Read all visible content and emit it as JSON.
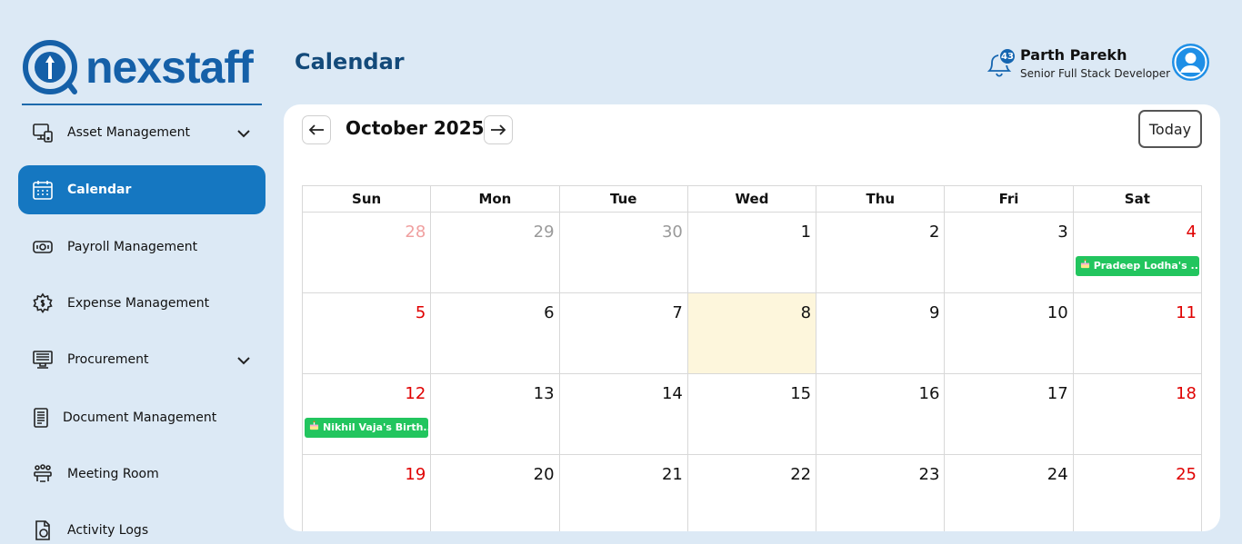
{
  "brand": {
    "name": "nexstaff"
  },
  "sidebar": {
    "items": [
      {
        "label": "Asset Management",
        "icon": "monitor-phone-icon",
        "expandable": true,
        "active": false
      },
      {
        "label": "Calendar",
        "icon": "calendar-icon",
        "expandable": false,
        "active": true
      },
      {
        "label": "Payroll Management",
        "icon": "money-icon",
        "expandable": false,
        "active": false
      },
      {
        "label": "Expense Management",
        "icon": "gear-dollar-icon",
        "expandable": false,
        "active": false
      },
      {
        "label": "Procurement",
        "icon": "desktop-icon",
        "expandable": true,
        "active": false
      },
      {
        "label": "Document Management",
        "icon": "document-icon",
        "expandable": false,
        "active": false
      },
      {
        "label": "Meeting Room",
        "icon": "meeting-icon",
        "expandable": false,
        "active": false
      },
      {
        "label": "Activity Logs",
        "icon": "activity-log-icon",
        "expandable": false,
        "active": false
      }
    ]
  },
  "header": {
    "title": "Calendar",
    "notifications": "43",
    "user": {
      "name": "Parth Parekh",
      "role": "Senior Full Stack Developer"
    }
  },
  "calendar": {
    "month_label": "October 2025",
    "today_label": "Today",
    "weekdays": [
      "Sun",
      "Mon",
      "Tue",
      "Wed",
      "Thu",
      "Fri",
      "Sat"
    ],
    "weeks": [
      [
        {
          "day": "28",
          "other": true
        },
        {
          "day": "29",
          "other": true
        },
        {
          "day": "30",
          "other": true
        },
        {
          "day": "1"
        },
        {
          "day": "2"
        },
        {
          "day": "3"
        },
        {
          "day": "4",
          "event": "Pradeep Lodha's ..."
        }
      ],
      [
        {
          "day": "5"
        },
        {
          "day": "6"
        },
        {
          "day": "7"
        },
        {
          "day": "8",
          "today": true
        },
        {
          "day": "9"
        },
        {
          "day": "10"
        },
        {
          "day": "11"
        }
      ],
      [
        {
          "day": "12",
          "event": "Nikhil Vaja's Birth..."
        },
        {
          "day": "13"
        },
        {
          "day": "14"
        },
        {
          "day": "15"
        },
        {
          "day": "16"
        },
        {
          "day": "17"
        },
        {
          "day": "18"
        }
      ],
      [
        {
          "day": "19"
        },
        {
          "day": "20"
        },
        {
          "day": "21"
        },
        {
          "day": "22"
        },
        {
          "day": "23"
        },
        {
          "day": "24"
        },
        {
          "day": "25"
        }
      ]
    ]
  },
  "colors": {
    "accent": "#1577c1",
    "event": "#22c55e",
    "weekend": "#e00000",
    "today_bg": "#fdf6dc",
    "background": "#dce9f5"
  }
}
